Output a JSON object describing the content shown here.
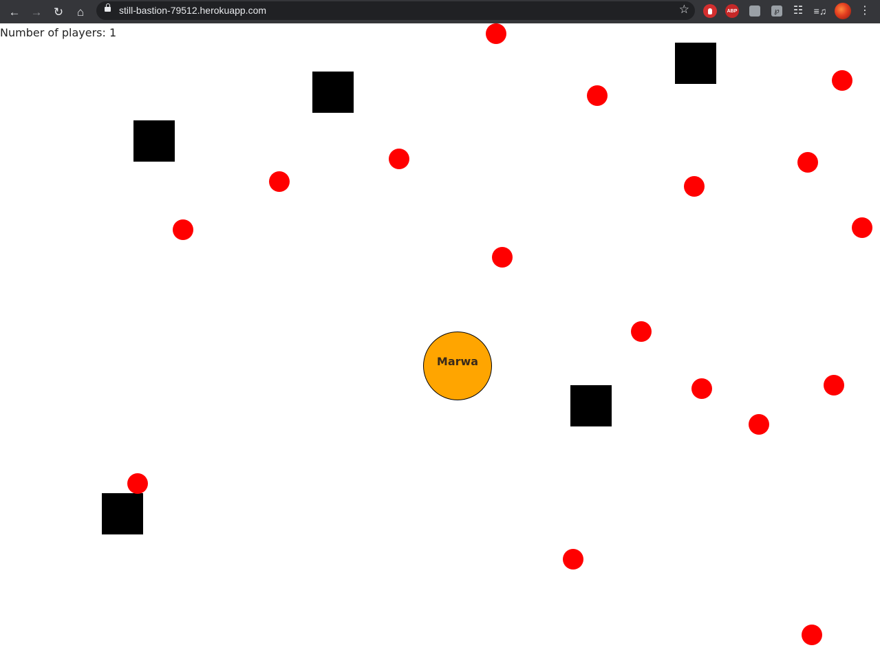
{
  "browser": {
    "url": "still-bastion-79512.herokuapp.com",
    "nav_icons": [
      "back-arrow-icon",
      "forward-arrow-icon",
      "reload-icon",
      "home-icon"
    ],
    "extension_icons": [
      "hand-block-extension-icon",
      "adblock-plus-icon",
      "extension-icon",
      "extension-icon",
      "puzzle-icon",
      "media-playlist-icon",
      "profile-avatar",
      "kebab-menu-icon"
    ],
    "abp_label": "ABP"
  },
  "game": {
    "players_text": "Number of players: 1",
    "player": {
      "name": "Marwa",
      "color": "#ffa500"
    },
    "food_color": "#ff0000",
    "obstacle_color": "#000000"
  }
}
